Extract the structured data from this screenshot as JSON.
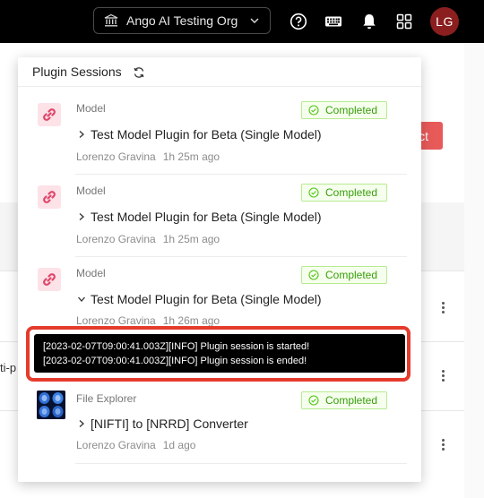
{
  "topbar": {
    "org_name": "Ango AI Testing Org",
    "avatar_initials": "LG",
    "icons": [
      "bank-icon",
      "chevron-down-icon",
      "help-icon",
      "keyboard-icon",
      "bell-icon",
      "apps-grid-icon"
    ]
  },
  "background": {
    "action_button_label": "ct",
    "truncated_text": "ti-p"
  },
  "plugin_sessions": {
    "title": "Plugin Sessions",
    "items": [
      {
        "type": "Model",
        "status": "Completed",
        "title": "Test Model Plugin for Beta (Single Model)",
        "expanded": false,
        "user": "Lorenzo Gravina",
        "time": "1h 25m ago"
      },
      {
        "type": "Model",
        "status": "Completed",
        "title": "Test Model Plugin for Beta (Single Model)",
        "expanded": false,
        "user": "Lorenzo Gravina",
        "time": "1h 25m ago"
      },
      {
        "type": "Model",
        "status": "Completed",
        "title": "Test Model Plugin for Beta (Single Model)",
        "expanded": true,
        "user": "Lorenzo Gravina",
        "time": "1h 26m ago",
        "logs": [
          "[2023-02-07T09:00:41.003Z][INFO] Plugin session is started!",
          "[2023-02-07T09:00:41.003Z][INFO] Plugin session is ended!"
        ]
      },
      {
        "type": "File Explorer",
        "status": "Completed",
        "title": "[NIFTI] to [NRRD] Converter",
        "expanded": false,
        "user": "Lorenzo Gravina",
        "time": "1d ago"
      }
    ]
  },
  "colors": {
    "topbar_bg": "#000000",
    "avatar_bg": "#8b1e1e",
    "status_green": "#389e0d",
    "highlight_red": "#e53b2c",
    "primary_button": "#e85a5a"
  }
}
